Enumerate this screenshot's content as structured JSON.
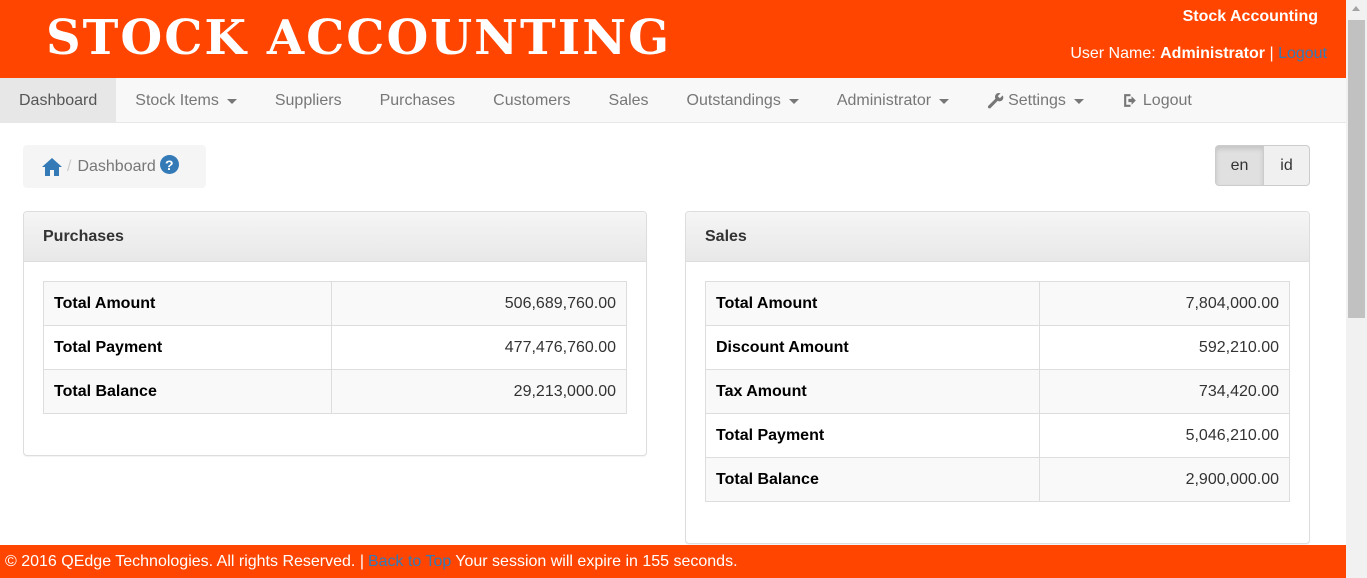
{
  "header": {
    "logo_text": "STOCK ACCOUNTING",
    "app_title": "Stock Accounting",
    "user_label": "User Name: ",
    "user_name": "Administrator",
    "separator": " | ",
    "logout_link": "Logout"
  },
  "nav": {
    "items": [
      {
        "label": "Dashboard"
      },
      {
        "label": "Stock Items"
      },
      {
        "label": "Suppliers"
      },
      {
        "label": "Purchases"
      },
      {
        "label": "Customers"
      },
      {
        "label": "Sales"
      },
      {
        "label": "Outstandings"
      },
      {
        "label": "Administrator"
      },
      {
        "label": "Settings",
        "icon": "wrench-icon"
      },
      {
        "label": "Logout",
        "icon": "logout-icon"
      }
    ]
  },
  "breadcrumb": {
    "separator": "/",
    "current": "Dashboard",
    "help_symbol": "?"
  },
  "lang": {
    "en": "en",
    "id": "id"
  },
  "purchases": {
    "title": "Purchases",
    "rows": [
      {
        "label": "Total Amount",
        "value": "506,689,760.00"
      },
      {
        "label": "Total Payment",
        "value": "477,476,760.00"
      },
      {
        "label": "Total Balance",
        "value": "29,213,000.00"
      }
    ]
  },
  "sales": {
    "title": "Sales",
    "rows": [
      {
        "label": "Total Amount",
        "value": "7,804,000.00"
      },
      {
        "label": "Discount Amount",
        "value": "592,210.00"
      },
      {
        "label": "Tax Amount",
        "value": "734,420.00"
      },
      {
        "label": "Total Payment",
        "value": "5,046,210.00"
      },
      {
        "label": "Total Balance",
        "value": "2,900,000.00"
      }
    ]
  },
  "footer": {
    "copyright": "© 2016 QEdge Technologies. All rights Reserved. |",
    "back_to_top": "Back to Top",
    "session_msg": "Your session will expire in 155 seconds."
  },
  "colors": {
    "brand": "#ff4500",
    "link": "#337ab7"
  }
}
